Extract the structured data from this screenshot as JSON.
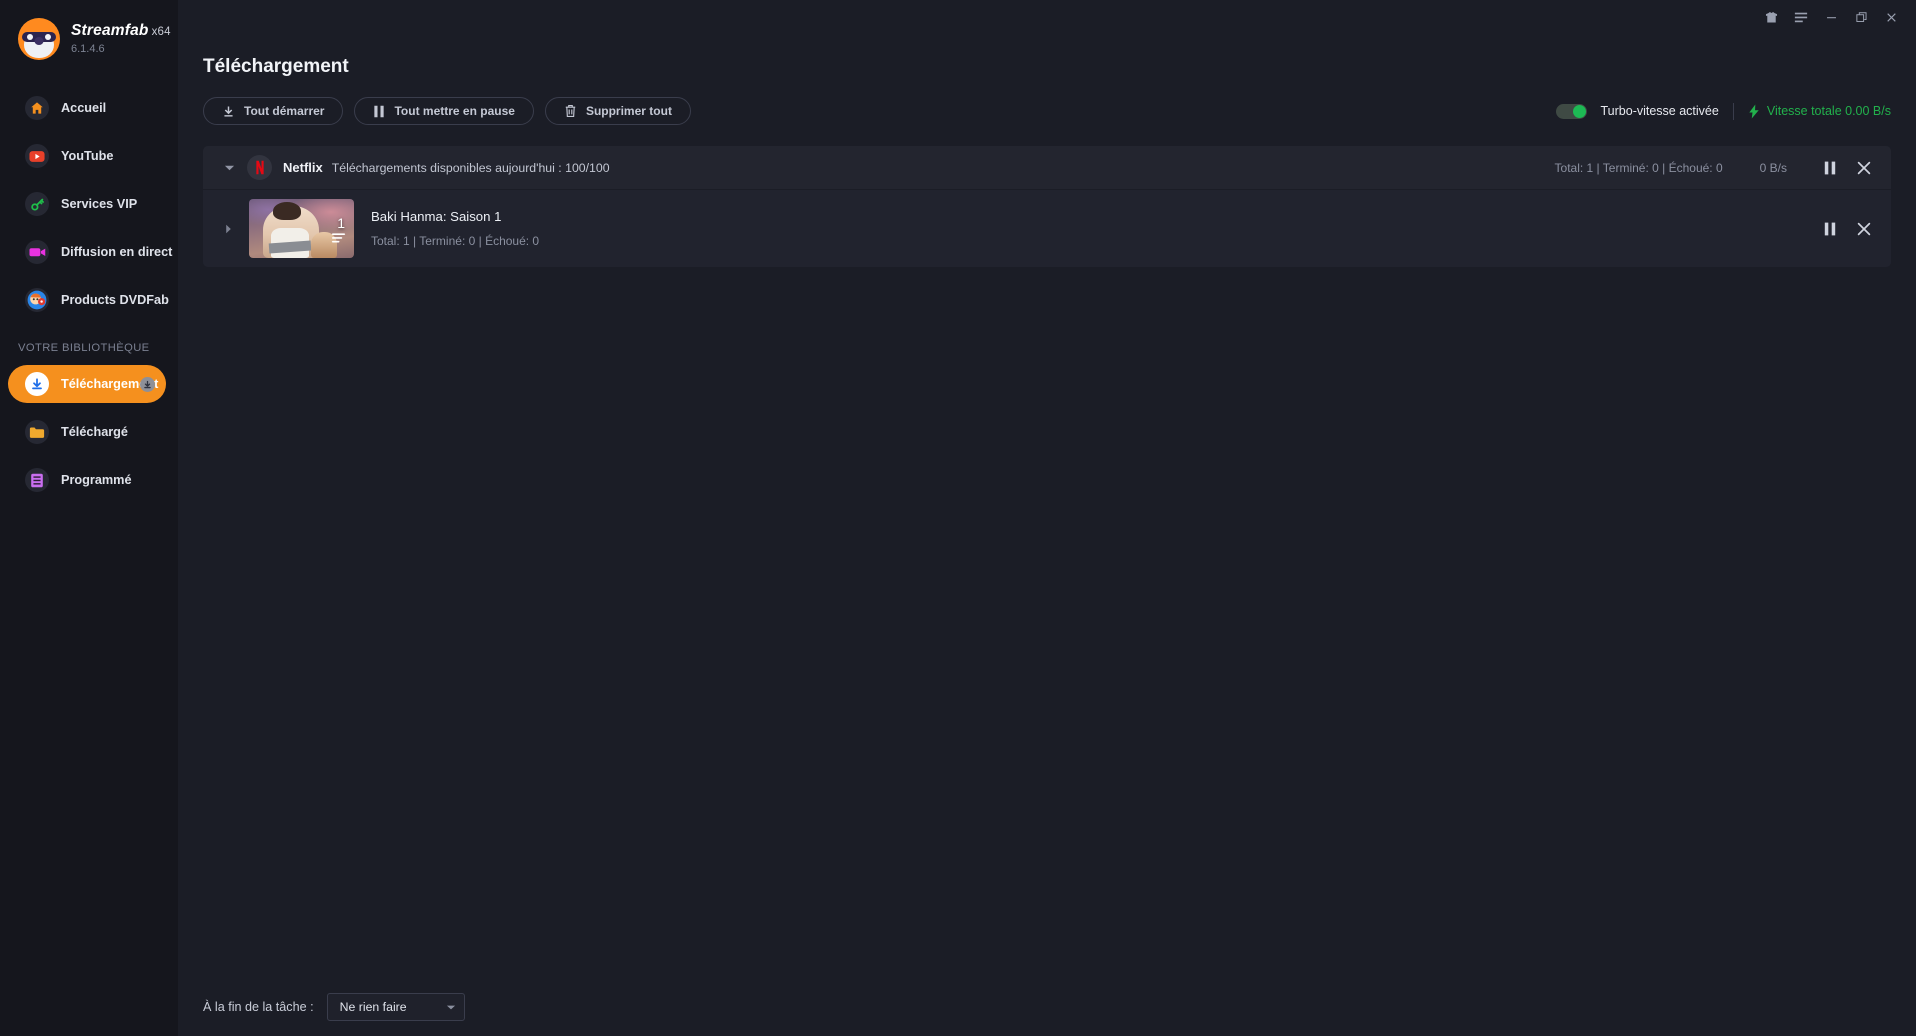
{
  "window": {
    "titlebar_buttons": [
      {
        "name": "gift-icon",
        "label": "Cadeau"
      },
      {
        "name": "menu-icon",
        "label": "Menu"
      },
      {
        "name": "minimize-icon",
        "label": "Réduire"
      },
      {
        "name": "maximize-icon",
        "label": "Agrandir"
      },
      {
        "name": "close-icon",
        "label": "Fermer"
      }
    ]
  },
  "brand": {
    "name": "Streamfab",
    "arch": "x64",
    "version": "6.1.4.6"
  },
  "sidebar": {
    "items": [
      {
        "label": "Accueil",
        "icon": "home-icon",
        "active": false
      },
      {
        "label": "YouTube",
        "icon": "youtube-icon",
        "active": false
      },
      {
        "label": "Services VIP",
        "icon": "key-icon",
        "active": false
      },
      {
        "label": "Diffusion en direct",
        "icon": "video-camera-icon",
        "active": false
      },
      {
        "label": "Products DVDFab",
        "icon": "dvdfab-icon",
        "active": false
      }
    ],
    "section_label": "VOTRE BIBLIOTHÈQUE",
    "library_items": [
      {
        "label": "Téléchargement",
        "icon": "download-icon",
        "active": true,
        "badge": "download-badge-icon"
      },
      {
        "label": "Téléchargé",
        "icon": "folder-icon",
        "active": false
      },
      {
        "label": "Programmé",
        "icon": "schedule-icon",
        "active": false
      }
    ]
  },
  "header": {
    "page_title": "Téléchargement"
  },
  "toolbar": {
    "start_all_label": "Tout démarrer",
    "pause_all_label": "Tout mettre en pause",
    "delete_all_label": "Supprimer tout",
    "turbo_label": "Turbo-vitesse activée",
    "turbo_enabled": true,
    "total_speed_label": "Vitesse totale 0.00 B/s",
    "speed_color": "#22b14c"
  },
  "group": {
    "site_name": "Netflix",
    "quota_text": "Téléchargements disponibles aujourd'hui : 100/100",
    "stats": "Total: 1  |  Terminé: 0  |  Échoué: 0",
    "speed": "0 B/s",
    "expanded": true
  },
  "task": {
    "title": "Baki Hanma: Saison 1",
    "stats": "Total: 1  |  Terminé: 0  |  Échoué: 0",
    "episode_badge": "1"
  },
  "footer": {
    "label": "À la fin de la tâche :",
    "select_value": "Ne rien faire"
  },
  "colors": {
    "accent": "#f5901e",
    "background": "#1b1d26",
    "sidebar_background": "#15161d",
    "panel": "#21232e",
    "green": "#22b14c"
  }
}
